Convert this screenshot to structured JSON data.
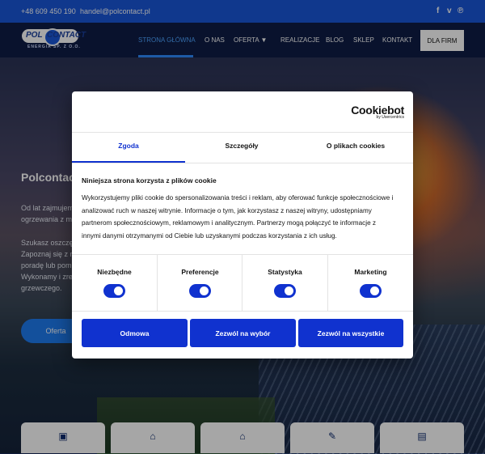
{
  "topbar": {
    "phone": "+48 609 450 190",
    "email": "handel@polcontact.pl",
    "social_icons": [
      "facebook-icon",
      "vimeo-icon",
      "pinterest-icon"
    ],
    "social_glyphs": [
      "f",
      "v",
      "℗"
    ]
  },
  "logo": {
    "pol": "POL",
    "contact": "CONTACT",
    "subtitle": "ENERGIA SP. Z O.O."
  },
  "nav": {
    "items": [
      "STRONA GŁÓWNA",
      "O NAS",
      "OFERTA",
      "REALIZACJE",
      "BLOG",
      "SKLEP",
      "KONTAKT"
    ],
    "oferta_caret": "▼",
    "cta": "DLA FIRM",
    "active_color": "#4da3ff"
  },
  "hero": {
    "title": "Polcontact",
    "lines": [
      "Od lat zajmujem",
      "ogrzewania z my",
      "Szukasz oszczęd",
      "Zapoznaj się z n",
      "poradę lub pom",
      "Wykonamy i zrea",
      "grzewczego."
    ],
    "button": "Oferta"
  },
  "cards": {
    "icons": [
      "briefcase-icon",
      "house-solar-icon",
      "house-fire-icon",
      "tools-icon",
      "document-icon"
    ],
    "glyphs": [
      "▣",
      "⌂",
      "⌂",
      "✎",
      "▤"
    ]
  },
  "cookie_dialog": {
    "brand": "Cookiebot",
    "brand_sub": "by Usercentrics",
    "tabs": [
      "Zgoda",
      "Szczegóły",
      "O plikach cookies"
    ],
    "active_tab": "Zgoda",
    "heading": "Niniejsza strona korzysta z plików cookie",
    "body_lines": [
      "Wykorzystujemy pliki cookie do spersonalizowania treści i reklam, aby oferować funkcje społecznościowe i",
      "analizować ruch w naszej witrynie. Informacje o tym, jak korzystasz z naszej witryny, udostępniamy",
      "partnerom społecznościowym, reklamowym i analitycznym. Partnerzy mogą połączyć te informacje z",
      "innymi danymi otrzymanymi od Ciebie lub uzyskanymi podczas korzystania z ich usług."
    ],
    "categories": [
      {
        "label": "Niezbędne",
        "enabled": true
      },
      {
        "label": "Preferencje",
        "enabled": true
      },
      {
        "label": "Statystyka",
        "enabled": true
      },
      {
        "label": "Marketing",
        "enabled": true
      }
    ],
    "buttons": [
      "Odmowa",
      "Zezwól na wybór",
      "Zezwól na wszystkie"
    ],
    "accent_color": "#1032cf"
  }
}
